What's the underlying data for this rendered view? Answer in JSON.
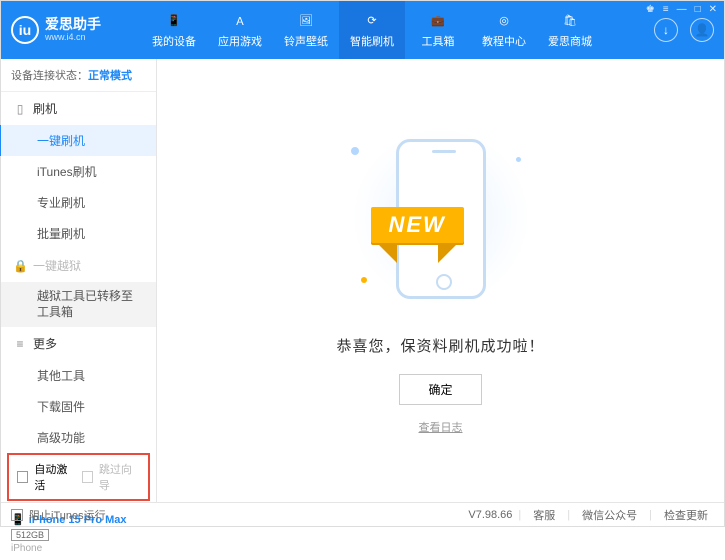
{
  "logo": {
    "mark": "iu",
    "title": "爱思助手",
    "url": "www.i4.cn"
  },
  "nav": [
    {
      "label": "我的设备"
    },
    {
      "label": "应用游戏"
    },
    {
      "label": "铃声壁纸"
    },
    {
      "label": "智能刷机"
    },
    {
      "label": "工具箱"
    },
    {
      "label": "教程中心"
    },
    {
      "label": "爱思商城"
    }
  ],
  "status": {
    "label": "设备连接状态：",
    "value": "正常模式"
  },
  "sidebar": {
    "flash": {
      "head": "刷机",
      "items": [
        "一键刷机",
        "iTunes刷机",
        "专业刷机",
        "批量刷机"
      ]
    },
    "jailbreak": {
      "head": "一键越狱",
      "note": "越狱工具已转移至工具箱"
    },
    "more": {
      "head": "更多",
      "items": [
        "其他工具",
        "下载固件",
        "高级功能"
      ]
    }
  },
  "checks": {
    "auto": "自动激活",
    "skip": "跳过向导"
  },
  "device": {
    "name": "iPhone 15 Pro Max",
    "storage": "512GB",
    "type": "iPhone"
  },
  "main": {
    "ribbon": "NEW",
    "message": "恭喜您，保资料刷机成功啦！",
    "ok": "确定",
    "log": "查看日志"
  },
  "footer": {
    "block": "阻止iTunes运行",
    "version": "V7.98.66",
    "links": [
      "客服",
      "微信公众号",
      "检查更新"
    ]
  }
}
